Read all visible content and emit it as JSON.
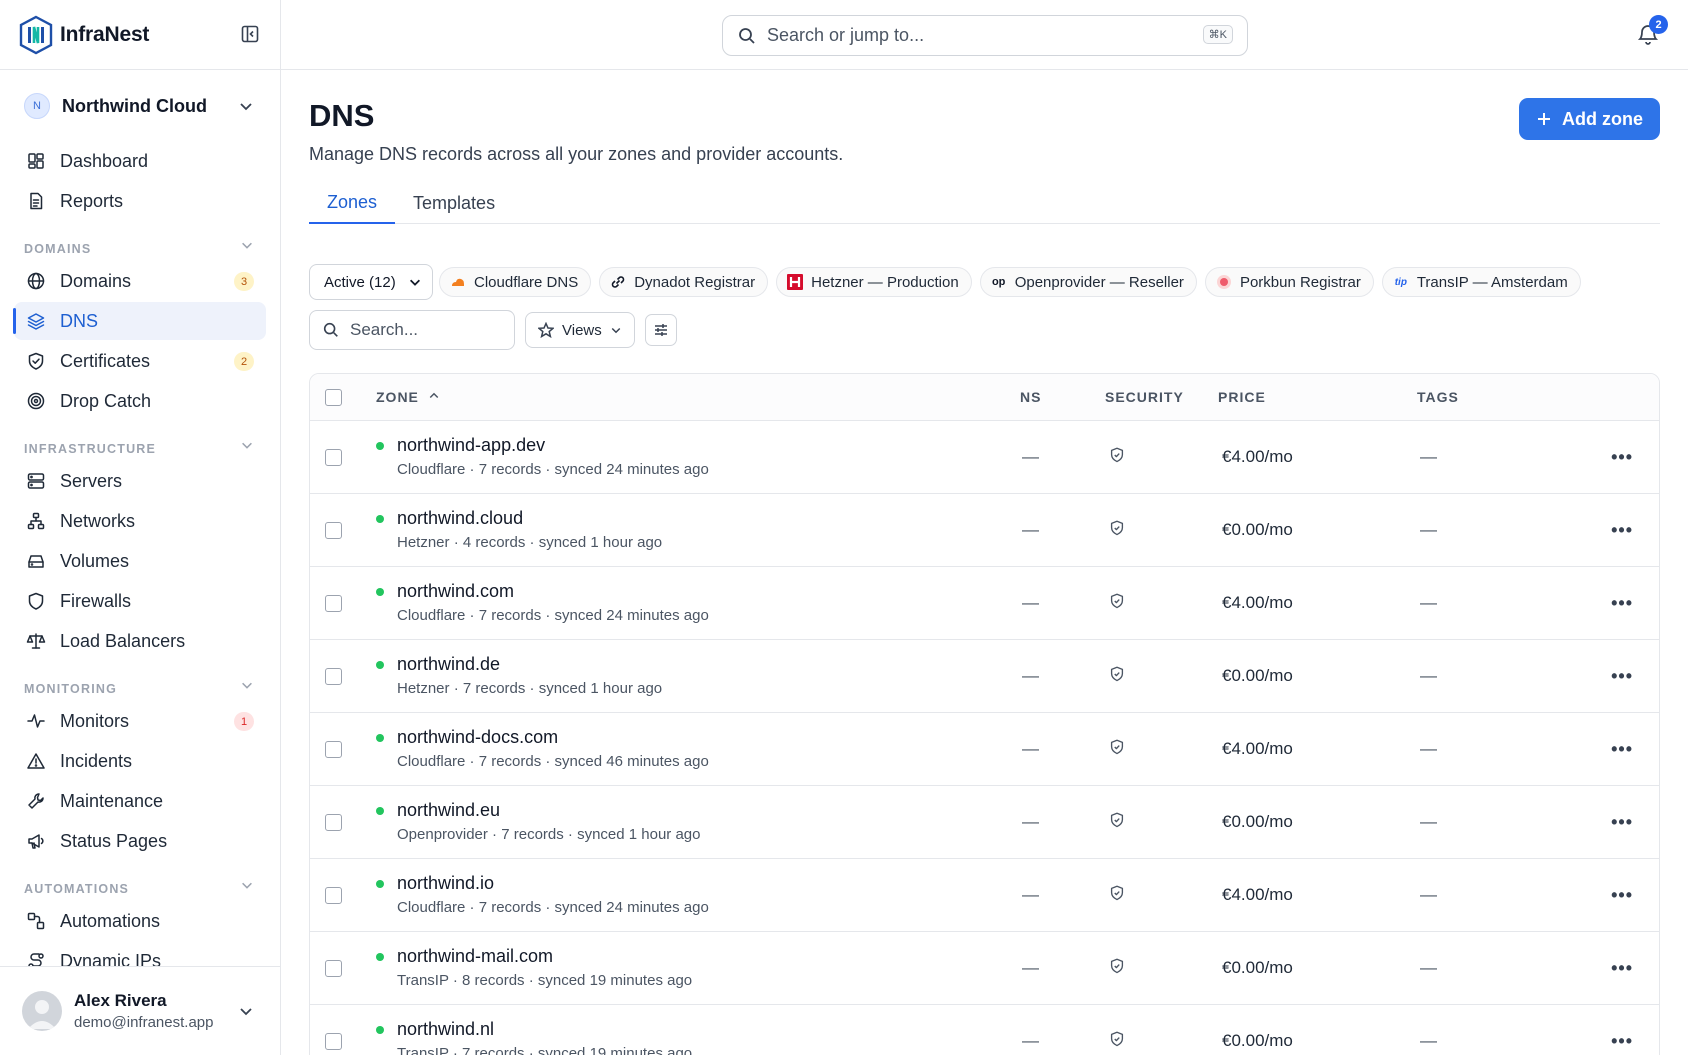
{
  "app": {
    "name": "InfraNest"
  },
  "org": {
    "initial": "N",
    "name": "Northwind Cloud"
  },
  "nav_top": [
    {
      "label": "Dashboard",
      "icon": "dashboard-icon"
    },
    {
      "label": "Reports",
      "icon": "reports-icon"
    }
  ],
  "sections": [
    {
      "title": "DOMAINS",
      "items": [
        {
          "label": "Domains",
          "icon": "globe-icon",
          "badge": "3",
          "badge_type": "warn"
        },
        {
          "label": "DNS",
          "icon": "layers-icon",
          "active": true
        },
        {
          "label": "Certificates",
          "icon": "shield-check-icon",
          "badge": "2",
          "badge_type": "warn"
        },
        {
          "label": "Drop Catch",
          "icon": "target-icon"
        }
      ]
    },
    {
      "title": "INFRASTRUCTURE",
      "items": [
        {
          "label": "Servers",
          "icon": "server-icon"
        },
        {
          "label": "Networks",
          "icon": "network-icon"
        },
        {
          "label": "Volumes",
          "icon": "volume-icon"
        },
        {
          "label": "Firewalls",
          "icon": "shield-icon"
        },
        {
          "label": "Load Balancers",
          "icon": "scale-icon"
        }
      ]
    },
    {
      "title": "MONITORING",
      "items": [
        {
          "label": "Monitors",
          "icon": "activity-icon",
          "badge": "1",
          "badge_type": "err"
        },
        {
          "label": "Incidents",
          "icon": "alert-icon"
        },
        {
          "label": "Maintenance",
          "icon": "wrench-icon"
        },
        {
          "label": "Status Pages",
          "icon": "megaphone-icon"
        }
      ]
    },
    {
      "title": "AUTOMATIONS",
      "items": [
        {
          "label": "Automations",
          "icon": "workflow-icon"
        },
        {
          "label": "Dynamic IPs",
          "icon": "route-icon"
        }
      ]
    }
  ],
  "user": {
    "name": "Alex Rivera",
    "email": "demo@infranest.app"
  },
  "topbar": {
    "search_placeholder": "Search or jump to...",
    "shortcut": "⌘K",
    "notifications": "2"
  },
  "page": {
    "title": "DNS",
    "subtitle": "Manage DNS records across all your zones and provider accounts.",
    "add_label": "Add zone",
    "tabs": [
      "Zones",
      "Templates"
    ],
    "status_filter": "Active (12)",
    "providers": [
      {
        "label": "Cloudflare DNS",
        "icon": "cloudflare-icon"
      },
      {
        "label": "Dynadot Registrar",
        "icon": "dynadot-icon"
      },
      {
        "label": "Hetzner — Production",
        "icon": "hetzner-icon"
      },
      {
        "label": "Openprovider — Reseller",
        "icon": "openprovider-icon"
      },
      {
        "label": "Porkbun Registrar",
        "icon": "porkbun-icon"
      },
      {
        "label": "TransIP — Amsterdam",
        "icon": "transip-icon"
      }
    ],
    "search_placeholder": "Search...",
    "views_label": "Views"
  },
  "table": {
    "headers": {
      "zone": "ZONE",
      "ns": "NS",
      "security": "SECURITY",
      "price": "PRICE",
      "tags": "TAGS"
    },
    "rows": [
      {
        "zone": "northwind-app.dev",
        "meta": "Cloudflare · 7 records · synced 24 minutes ago",
        "ns": "—",
        "price": "€4.00/mo",
        "tags": "—"
      },
      {
        "zone": "northwind.cloud",
        "meta": "Hetzner · 4 records · synced 1 hour ago",
        "ns": "—",
        "price": "€0.00/mo",
        "tags": "—"
      },
      {
        "zone": "northwind.com",
        "meta": "Cloudflare · 7 records · synced 24 minutes ago",
        "ns": "—",
        "price": "€4.00/mo",
        "tags": "—"
      },
      {
        "zone": "northwind.de",
        "meta": "Hetzner · 7 records · synced 1 hour ago",
        "ns": "—",
        "price": "€0.00/mo",
        "tags": "—"
      },
      {
        "zone": "northwind-docs.com",
        "meta": "Cloudflare · 7 records · synced 46 minutes ago",
        "ns": "—",
        "price": "€4.00/mo",
        "tags": "—"
      },
      {
        "zone": "northwind.eu",
        "meta": "Openprovider · 7 records · synced 1 hour ago",
        "ns": "—",
        "price": "€0.00/mo",
        "tags": "—"
      },
      {
        "zone": "northwind.io",
        "meta": "Cloudflare · 7 records · synced 24 minutes ago",
        "ns": "—",
        "price": "€4.00/mo",
        "tags": "—"
      },
      {
        "zone": "northwind-mail.com",
        "meta": "TransIP · 8 records · synced 19 minutes ago",
        "ns": "—",
        "price": "€0.00/mo",
        "tags": "—"
      },
      {
        "zone": "northwind.nl",
        "meta": "TransIP · 7 records · synced 19 minutes ago",
        "ns": "—",
        "price": "€0.00/mo",
        "tags": "—"
      }
    ]
  },
  "colors": {
    "accent": "#2563eb",
    "status_ok": "#22c55e"
  }
}
